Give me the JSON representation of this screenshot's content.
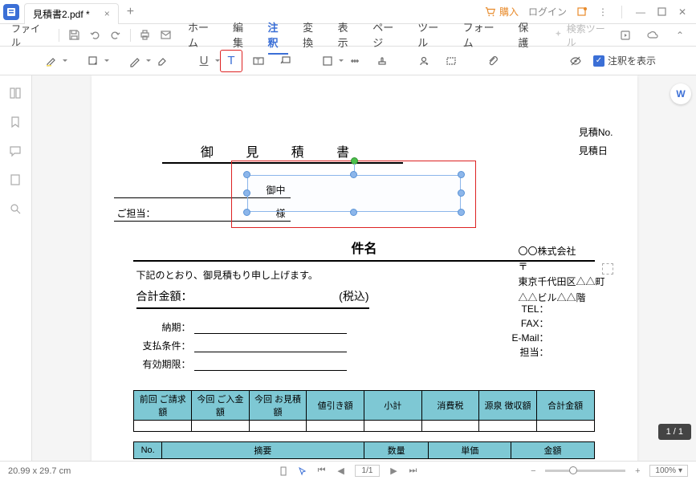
{
  "titlebar": {
    "tab_title": "見積書2.pdf *",
    "buy": "購入",
    "login": "ログイン"
  },
  "menu": {
    "file": "ファイル",
    "tabs": [
      "ホーム",
      "編集",
      "注釈",
      "変換",
      "表示",
      "ページ",
      "ツール",
      "フォーム",
      "保護"
    ],
    "active_index": 2,
    "search": "検索ツール"
  },
  "toolbar": {
    "show_annot": "注釈を表示"
  },
  "document": {
    "title": "御 見 積 書",
    "quote_no": "見積No.",
    "quote_date": "見積日",
    "onchu": "御中",
    "gotanto": "ご担当：",
    "sama": "様",
    "subject": "件名",
    "note": "下記のとおり、御見積もり申し上げます。",
    "total_label": "合計金額：",
    "tax_incl": "(税込)",
    "company": {
      "name": "〇〇株式会社",
      "postal": "〒",
      "addr1": "東京千代田区△△町",
      "addr2": "△△ビル△△階"
    },
    "contact": {
      "tel": "TEL：",
      "fax": "FAX：",
      "email": "E-Mail：",
      "person": "担当："
    },
    "terms": {
      "delivery": "納期：",
      "payment": "支払条件：",
      "validity": "有効期限："
    },
    "table1_headers": [
      "前回\nご請求額",
      "今回\nご入金額",
      "今回\nお見積額",
      "値引き額",
      "小計",
      "消費税",
      "源泉\n徴収額",
      "合計金額"
    ],
    "table2_headers": [
      "No.",
      "摘要",
      "数量",
      "単価",
      "金額"
    ]
  },
  "floating": {
    "w": "W",
    "page_indicator": "1 / 1"
  },
  "status": {
    "dimensions": "20.99 x 29.7 cm",
    "page": "1/1",
    "zoom": "100%"
  }
}
